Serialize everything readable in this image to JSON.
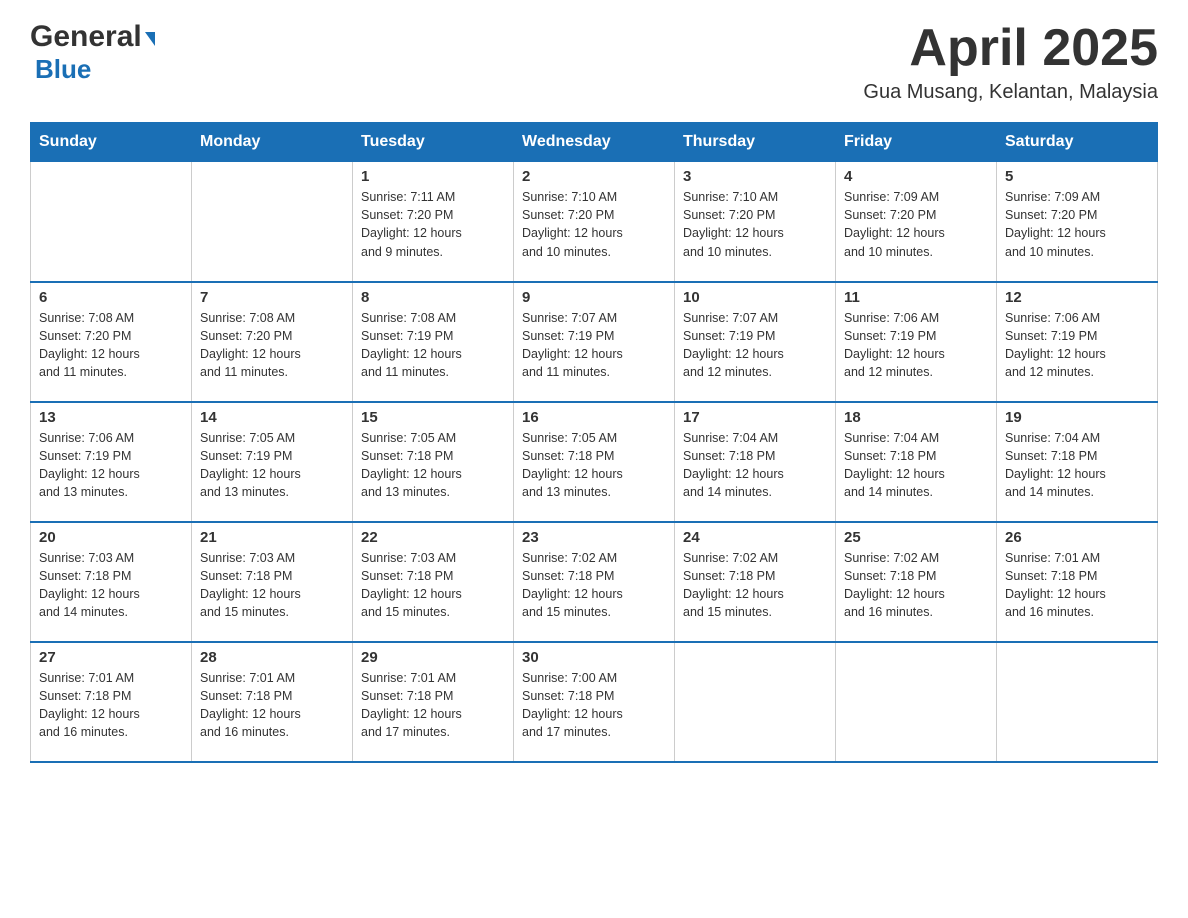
{
  "logo": {
    "general": "General",
    "blue": "Blue"
  },
  "title": {
    "month": "April 2025",
    "location": "Gua Musang, Kelantan, Malaysia"
  },
  "weekdays": [
    "Sunday",
    "Monday",
    "Tuesday",
    "Wednesday",
    "Thursday",
    "Friday",
    "Saturday"
  ],
  "weeks": [
    [
      {
        "day": "",
        "info": ""
      },
      {
        "day": "",
        "info": ""
      },
      {
        "day": "1",
        "info": "Sunrise: 7:11 AM\nSunset: 7:20 PM\nDaylight: 12 hours\nand 9 minutes."
      },
      {
        "day": "2",
        "info": "Sunrise: 7:10 AM\nSunset: 7:20 PM\nDaylight: 12 hours\nand 10 minutes."
      },
      {
        "day": "3",
        "info": "Sunrise: 7:10 AM\nSunset: 7:20 PM\nDaylight: 12 hours\nand 10 minutes."
      },
      {
        "day": "4",
        "info": "Sunrise: 7:09 AM\nSunset: 7:20 PM\nDaylight: 12 hours\nand 10 minutes."
      },
      {
        "day": "5",
        "info": "Sunrise: 7:09 AM\nSunset: 7:20 PM\nDaylight: 12 hours\nand 10 minutes."
      }
    ],
    [
      {
        "day": "6",
        "info": "Sunrise: 7:08 AM\nSunset: 7:20 PM\nDaylight: 12 hours\nand 11 minutes."
      },
      {
        "day": "7",
        "info": "Sunrise: 7:08 AM\nSunset: 7:20 PM\nDaylight: 12 hours\nand 11 minutes."
      },
      {
        "day": "8",
        "info": "Sunrise: 7:08 AM\nSunset: 7:19 PM\nDaylight: 12 hours\nand 11 minutes."
      },
      {
        "day": "9",
        "info": "Sunrise: 7:07 AM\nSunset: 7:19 PM\nDaylight: 12 hours\nand 11 minutes."
      },
      {
        "day": "10",
        "info": "Sunrise: 7:07 AM\nSunset: 7:19 PM\nDaylight: 12 hours\nand 12 minutes."
      },
      {
        "day": "11",
        "info": "Sunrise: 7:06 AM\nSunset: 7:19 PM\nDaylight: 12 hours\nand 12 minutes."
      },
      {
        "day": "12",
        "info": "Sunrise: 7:06 AM\nSunset: 7:19 PM\nDaylight: 12 hours\nand 12 minutes."
      }
    ],
    [
      {
        "day": "13",
        "info": "Sunrise: 7:06 AM\nSunset: 7:19 PM\nDaylight: 12 hours\nand 13 minutes."
      },
      {
        "day": "14",
        "info": "Sunrise: 7:05 AM\nSunset: 7:19 PM\nDaylight: 12 hours\nand 13 minutes."
      },
      {
        "day": "15",
        "info": "Sunrise: 7:05 AM\nSunset: 7:18 PM\nDaylight: 12 hours\nand 13 minutes."
      },
      {
        "day": "16",
        "info": "Sunrise: 7:05 AM\nSunset: 7:18 PM\nDaylight: 12 hours\nand 13 minutes."
      },
      {
        "day": "17",
        "info": "Sunrise: 7:04 AM\nSunset: 7:18 PM\nDaylight: 12 hours\nand 14 minutes."
      },
      {
        "day": "18",
        "info": "Sunrise: 7:04 AM\nSunset: 7:18 PM\nDaylight: 12 hours\nand 14 minutes."
      },
      {
        "day": "19",
        "info": "Sunrise: 7:04 AM\nSunset: 7:18 PM\nDaylight: 12 hours\nand 14 minutes."
      }
    ],
    [
      {
        "day": "20",
        "info": "Sunrise: 7:03 AM\nSunset: 7:18 PM\nDaylight: 12 hours\nand 14 minutes."
      },
      {
        "day": "21",
        "info": "Sunrise: 7:03 AM\nSunset: 7:18 PM\nDaylight: 12 hours\nand 15 minutes."
      },
      {
        "day": "22",
        "info": "Sunrise: 7:03 AM\nSunset: 7:18 PM\nDaylight: 12 hours\nand 15 minutes."
      },
      {
        "day": "23",
        "info": "Sunrise: 7:02 AM\nSunset: 7:18 PM\nDaylight: 12 hours\nand 15 minutes."
      },
      {
        "day": "24",
        "info": "Sunrise: 7:02 AM\nSunset: 7:18 PM\nDaylight: 12 hours\nand 15 minutes."
      },
      {
        "day": "25",
        "info": "Sunrise: 7:02 AM\nSunset: 7:18 PM\nDaylight: 12 hours\nand 16 minutes."
      },
      {
        "day": "26",
        "info": "Sunrise: 7:01 AM\nSunset: 7:18 PM\nDaylight: 12 hours\nand 16 minutes."
      }
    ],
    [
      {
        "day": "27",
        "info": "Sunrise: 7:01 AM\nSunset: 7:18 PM\nDaylight: 12 hours\nand 16 minutes."
      },
      {
        "day": "28",
        "info": "Sunrise: 7:01 AM\nSunset: 7:18 PM\nDaylight: 12 hours\nand 16 minutes."
      },
      {
        "day": "29",
        "info": "Sunrise: 7:01 AM\nSunset: 7:18 PM\nDaylight: 12 hours\nand 17 minutes."
      },
      {
        "day": "30",
        "info": "Sunrise: 7:00 AM\nSunset: 7:18 PM\nDaylight: 12 hours\nand 17 minutes."
      },
      {
        "day": "",
        "info": ""
      },
      {
        "day": "",
        "info": ""
      },
      {
        "day": "",
        "info": ""
      }
    ]
  ]
}
